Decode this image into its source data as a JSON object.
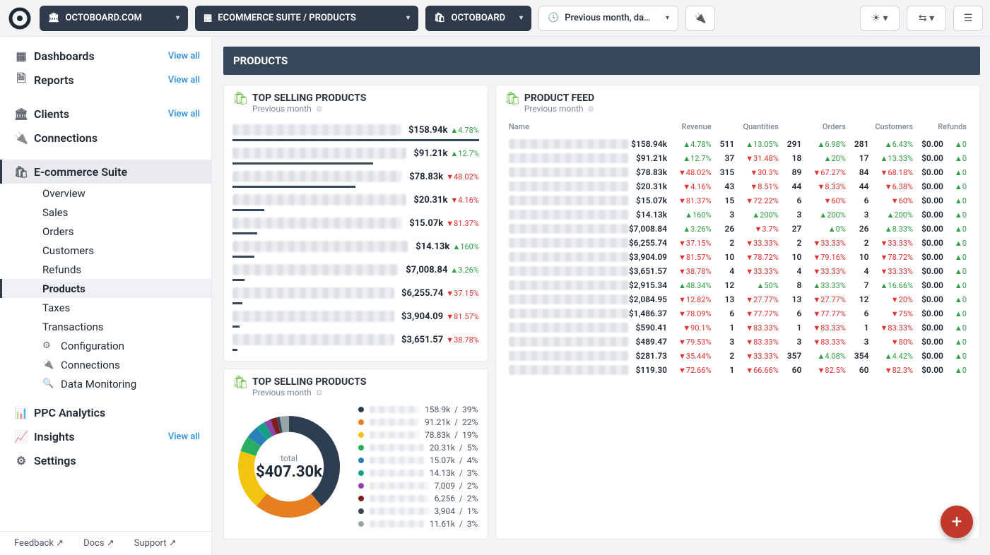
{
  "top": {
    "org": "OCTOBOARD.COM",
    "suite": "ECOMMERCE SUITE / PRODUCTS",
    "brand": "OCTOBOARD",
    "range": "Previous month, da…"
  },
  "sidebar": {
    "items": [
      {
        "icon": "▦",
        "label": "Dashboards",
        "va": "View all"
      },
      {
        "icon": "🗎",
        "label": "Reports",
        "va": "View all"
      },
      {
        "icon": "🏛",
        "label": "Clients",
        "va": "View all"
      },
      {
        "icon": "🔌",
        "label": "Connections",
        "va": ""
      },
      {
        "icon": "🛍",
        "label": "E-commerce Suite",
        "va": "",
        "sel": true
      },
      {
        "icon": "📊",
        "label": "PPC Analytics",
        "va": ""
      },
      {
        "icon": "📈",
        "label": "Insights",
        "va": "View all"
      },
      {
        "icon": "⚙",
        "label": "Settings",
        "va": ""
      }
    ],
    "ecom": [
      {
        "label": "Overview"
      },
      {
        "label": "Sales"
      },
      {
        "label": "Orders"
      },
      {
        "label": "Customers"
      },
      {
        "label": "Refunds"
      },
      {
        "label": "Products",
        "sel": true
      },
      {
        "label": "Taxes"
      },
      {
        "label": "Transactions"
      },
      {
        "icon": "⚙",
        "label": "Configuration"
      },
      {
        "icon": "🔌",
        "label": "Connections"
      },
      {
        "icon": "🔍",
        "label": "Data Monitoring"
      }
    ],
    "footer": {
      "feedback": "Feedback ↗",
      "docs": "Docs ↗",
      "support": "Support ↗"
    }
  },
  "page": {
    "title": "PRODUCTS",
    "prevmonth": "Previous month",
    "card1": "TOP SELLING PRODUCTS",
    "card2": "PRODUCT FEED",
    "card3": "TOP SELLING PRODUCTS",
    "total_label": "total",
    "total_value": "$407.30k"
  },
  "topselling": [
    {
      "val": "$158.94k",
      "d": "▲4.78%",
      "dir": "up",
      "bar": 100
    },
    {
      "val": "$91.21k",
      "d": "▲12.7%",
      "dir": "up",
      "bar": 57
    },
    {
      "val": "$78.83k",
      "d": "▼48.02%",
      "dir": "dn",
      "bar": 50
    },
    {
      "val": "$20.31k",
      "d": "▼4.16%",
      "dir": "dn",
      "bar": 13
    },
    {
      "val": "$15.07k",
      "d": "▼81.37%",
      "dir": "dn",
      "bar": 10
    },
    {
      "val": "$14.13k",
      "d": "▲160%",
      "dir": "up",
      "bar": 9
    },
    {
      "val": "$7,008.84",
      "d": "▲3.26%",
      "dir": "up",
      "bar": 5
    },
    {
      "val": "$6,255.74",
      "d": "▼37.15%",
      "dir": "dn",
      "bar": 4
    },
    {
      "val": "$3,904.09",
      "d": "▼81.57%",
      "dir": "dn",
      "bar": 3
    },
    {
      "val": "$3,651.57",
      "d": "▼38.78%",
      "dir": "dn",
      "bar": 2
    }
  ],
  "feedhead": [
    "Name",
    "Revenue",
    "Quantities",
    "Orders",
    "Customers",
    "Refunds"
  ],
  "feed": [
    {
      "rev": "$158.94k",
      "rd": "▲4.78%",
      "rdir": "up",
      "q": "511",
      "qd": "▲13.05%",
      "qdir": "up",
      "o": "291",
      "od": "▲6.98%",
      "odir": "up",
      "c": "281",
      "cd": "▲6.43%",
      "cdir": "up",
      "rf": "$0.00",
      "rfd": "▲0",
      "rfdir": "up"
    },
    {
      "rev": "$91.21k",
      "rd": "▲12.7%",
      "rdir": "up",
      "q": "37",
      "qd": "▼31.48%",
      "qdir": "dn",
      "o": "18",
      "od": "▲20%",
      "odir": "up",
      "c": "17",
      "cd": "▲13.33%",
      "cdir": "up",
      "rf": "$0.00",
      "rfd": "▲0",
      "rfdir": "up"
    },
    {
      "rev": "$78.83k",
      "rd": "▼48.02%",
      "rdir": "dn",
      "q": "315",
      "qd": "▼30.3%",
      "qdir": "dn",
      "o": "89",
      "od": "▼67.27%",
      "odir": "dn",
      "c": "84",
      "cd": "▼68.18%",
      "cdir": "dn",
      "rf": "$0.00",
      "rfd": "▲0",
      "rfdir": "up"
    },
    {
      "rev": "$20.31k",
      "rd": "▼4.16%",
      "rdir": "dn",
      "q": "43",
      "qd": "▼8.51%",
      "qdir": "dn",
      "o": "44",
      "od": "▼8.33%",
      "odir": "dn",
      "c": "44",
      "cd": "▼6.38%",
      "cdir": "dn",
      "rf": "$0.00",
      "rfd": "▲0",
      "rfdir": "up"
    },
    {
      "rev": "$15.07k",
      "rd": "▼81.37%",
      "rdir": "dn",
      "q": "15",
      "qd": "▼72.22%",
      "qdir": "dn",
      "o": "6",
      "od": "▼60%",
      "odir": "dn",
      "c": "6",
      "cd": "▼60%",
      "cdir": "dn",
      "rf": "$0.00",
      "rfd": "▲0",
      "rfdir": "up"
    },
    {
      "rev": "$14.13k",
      "rd": "▲160%",
      "rdir": "up",
      "q": "3",
      "qd": "▲200%",
      "qdir": "up",
      "o": "3",
      "od": "▲200%",
      "odir": "up",
      "c": "3",
      "cd": "▲200%",
      "cdir": "up",
      "rf": "$0.00",
      "rfd": "▲0",
      "rfdir": "up"
    },
    {
      "rev": "$7,008.84",
      "rd": "▲3.26%",
      "rdir": "up",
      "q": "26",
      "qd": "▼3.7%",
      "qdir": "dn",
      "o": "27",
      "od": "▲0%",
      "odir": "up",
      "c": "26",
      "cd": "▲8.33%",
      "cdir": "up",
      "rf": "$0.00",
      "rfd": "▲0",
      "rfdir": "up"
    },
    {
      "rev": "$6,255.74",
      "rd": "▼37.15%",
      "rdir": "dn",
      "q": "2",
      "qd": "▼33.33%",
      "qdir": "dn",
      "o": "2",
      "od": "▼33.33%",
      "odir": "dn",
      "c": "2",
      "cd": "▼33.33%",
      "cdir": "dn",
      "rf": "$0.00",
      "rfd": "▲0",
      "rfdir": "up"
    },
    {
      "rev": "$3,904.09",
      "rd": "▼81.57%",
      "rdir": "dn",
      "q": "10",
      "qd": "▼78.72%",
      "qdir": "dn",
      "o": "10",
      "od": "▼79.16%",
      "odir": "dn",
      "c": "10",
      "cd": "▼78.72%",
      "cdir": "dn",
      "rf": "$0.00",
      "rfd": "▲0",
      "rfdir": "up"
    },
    {
      "rev": "$3,651.57",
      "rd": "▼38.78%",
      "rdir": "dn",
      "q": "4",
      "qd": "▼33.33%",
      "qdir": "dn",
      "o": "4",
      "od": "▼33.33%",
      "odir": "dn",
      "c": "4",
      "cd": "▼33.33%",
      "cdir": "dn",
      "rf": "$0.00",
      "rfd": "▲0",
      "rfdir": "up"
    },
    {
      "rev": "$2,915.34",
      "rd": "▲48.34%",
      "rdir": "up",
      "q": "12",
      "qd": "▲50%",
      "qdir": "up",
      "o": "8",
      "od": "▲33.33%",
      "odir": "up",
      "c": "7",
      "cd": "▲16.66%",
      "cdir": "up",
      "rf": "$0.00",
      "rfd": "▲0",
      "rfdir": "up"
    },
    {
      "rev": "$2,084.95",
      "rd": "▼12.82%",
      "rdir": "dn",
      "q": "13",
      "qd": "▼27.77%",
      "qdir": "dn",
      "o": "13",
      "od": "▼27.77%",
      "odir": "dn",
      "c": "12",
      "cd": "▼20%",
      "cdir": "dn",
      "rf": "$0.00",
      "rfd": "▲0",
      "rfdir": "up"
    },
    {
      "rev": "$1,486.37",
      "rd": "▼78.09%",
      "rdir": "dn",
      "q": "6",
      "qd": "▼77.77%",
      "qdir": "dn",
      "o": "6",
      "od": "▼77.77%",
      "odir": "dn",
      "c": "6",
      "cd": "▼75%",
      "cdir": "dn",
      "rf": "$0.00",
      "rfd": "▲0",
      "rfdir": "up"
    },
    {
      "rev": "$590.41",
      "rd": "▼90.1%",
      "rdir": "dn",
      "q": "1",
      "qd": "▼83.33%",
      "qdir": "dn",
      "o": "1",
      "od": "▼83.33%",
      "odir": "dn",
      "c": "1",
      "cd": "▼83.33%",
      "cdir": "dn",
      "rf": "$0.00",
      "rfd": "▲0",
      "rfdir": "up"
    },
    {
      "rev": "$489.47",
      "rd": "▼79.53%",
      "rdir": "dn",
      "q": "3",
      "qd": "▼83.33%",
      "qdir": "dn",
      "o": "3",
      "od": "▼83.33%",
      "odir": "dn",
      "c": "3",
      "cd": "▼80%",
      "cdir": "dn",
      "rf": "$0.00",
      "rfd": "▲0",
      "rfdir": "up"
    },
    {
      "rev": "$281.73",
      "rd": "▼35.44%",
      "rdir": "dn",
      "q": "2",
      "qd": "▼33.33%",
      "qdir": "dn",
      "o": "357",
      "od": "▲4.08%",
      "odir": "up",
      "c": "354",
      "cd": "▲4.42%",
      "cdir": "up",
      "rf": "$0.00",
      "rfd": "▲0",
      "rfdir": "up"
    },
    {
      "rev": "$119.30",
      "rd": "▼72.66%",
      "rdir": "dn",
      "q": "1",
      "qd": "▼66.66%",
      "qdir": "dn",
      "o": "60",
      "od": "▼82.5%",
      "odir": "dn",
      "c": "60",
      "cd": "▼82.3%",
      "cdir": "dn",
      "rf": "$0.00",
      "rfd": "▲0",
      "rfdir": "up"
    }
  ],
  "donut": {
    "colors": [
      "#2c3e50",
      "#e67e22",
      "#f1c40f",
      "#27ae60",
      "#2980b9",
      "#16a085",
      "#8e44ad",
      "#7f1d1d",
      "#34495e",
      "#95a5a6"
    ],
    "legend": [
      {
        "v": "158.9k",
        "p": "39%"
      },
      {
        "v": "91.21k",
        "p": "22%"
      },
      {
        "v": "78.83k",
        "p": "19%"
      },
      {
        "v": "20.31k",
        "p": "5%"
      },
      {
        "v": "15.07k",
        "p": "4%"
      },
      {
        "v": "14.13k",
        "p": "3%"
      },
      {
        "v": "7,009",
        "p": "2%"
      },
      {
        "v": "6,256",
        "p": "2%"
      },
      {
        "v": "3,904",
        "p": "1%"
      },
      {
        "v": "11.61k",
        "p": "3%"
      }
    ],
    "pct": [
      39,
      22,
      19,
      5,
      4,
      3,
      2,
      2,
      1,
      3
    ]
  },
  "chart_data": {
    "type": "pie",
    "title": "TOP SELLING PRODUCTS",
    "total": "$407.30k",
    "series": [
      {
        "name": "Product 1",
        "value": 158900,
        "pct": 39
      },
      {
        "name": "Product 2",
        "value": 91210,
        "pct": 22
      },
      {
        "name": "Product 3",
        "value": 78830,
        "pct": 19
      },
      {
        "name": "Product 4",
        "value": 20310,
        "pct": 5
      },
      {
        "name": "Product 5",
        "value": 15070,
        "pct": 4
      },
      {
        "name": "Product 6",
        "value": 14130,
        "pct": 3
      },
      {
        "name": "Product 7",
        "value": 7009,
        "pct": 2
      },
      {
        "name": "Product 8",
        "value": 6256,
        "pct": 2
      },
      {
        "name": "Product 9",
        "value": 3904,
        "pct": 1
      },
      {
        "name": "Others",
        "value": 11610,
        "pct": 3
      }
    ]
  }
}
